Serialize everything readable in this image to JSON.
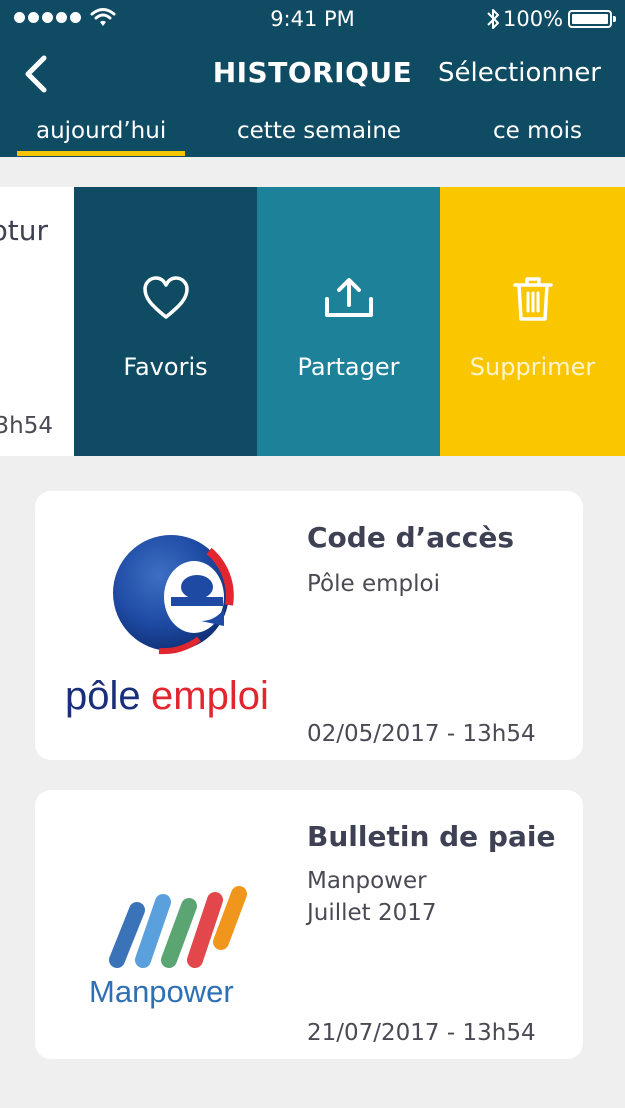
{
  "status_bar": {
    "time": "9:41 PM",
    "battery_pct": "100%",
    "signal_icon": "signal-dots-icon",
    "wifi_icon": "wifi-icon",
    "bluetooth_icon": "bluetooth-icon"
  },
  "header": {
    "title": "HISTORIQUE",
    "select_label": "Sélectionner",
    "back_icon": "chevron-left-icon"
  },
  "tabs": [
    {
      "label": "aujourd’hui",
      "active": true
    },
    {
      "label": "cette semaine",
      "active": false
    },
    {
      "label": "ce mois",
      "active": false
    }
  ],
  "swiped_item": {
    "title_partial": "ptur",
    "date_partial": "3h54",
    "actions": [
      {
        "label": "Favoris",
        "icon": "heart-icon"
      },
      {
        "label": "Partager",
        "icon": "share-icon"
      },
      {
        "label": "Supprimer",
        "icon": "trash-icon"
      }
    ]
  },
  "items": [
    {
      "title": "Code d’accès",
      "subtitle": "Pôle emploi",
      "subtitle2": "",
      "date": "02/05/2017 - 13h54",
      "logo_text_1": "pôle",
      "logo_text_2": "emploi"
    },
    {
      "title": "Bulletin de paie",
      "subtitle": "Manpower",
      "subtitle2": "Juillet 2017",
      "date": "21/07/2017 - 13h54",
      "logo_text": "Manpower"
    }
  ],
  "colors": {
    "header": "#0f4b63",
    "tab_underline": "#f7c400",
    "favoris": "#0f4b63",
    "partager": "#1d8299",
    "supprimer": "#f9c600",
    "background": "#efefef"
  }
}
